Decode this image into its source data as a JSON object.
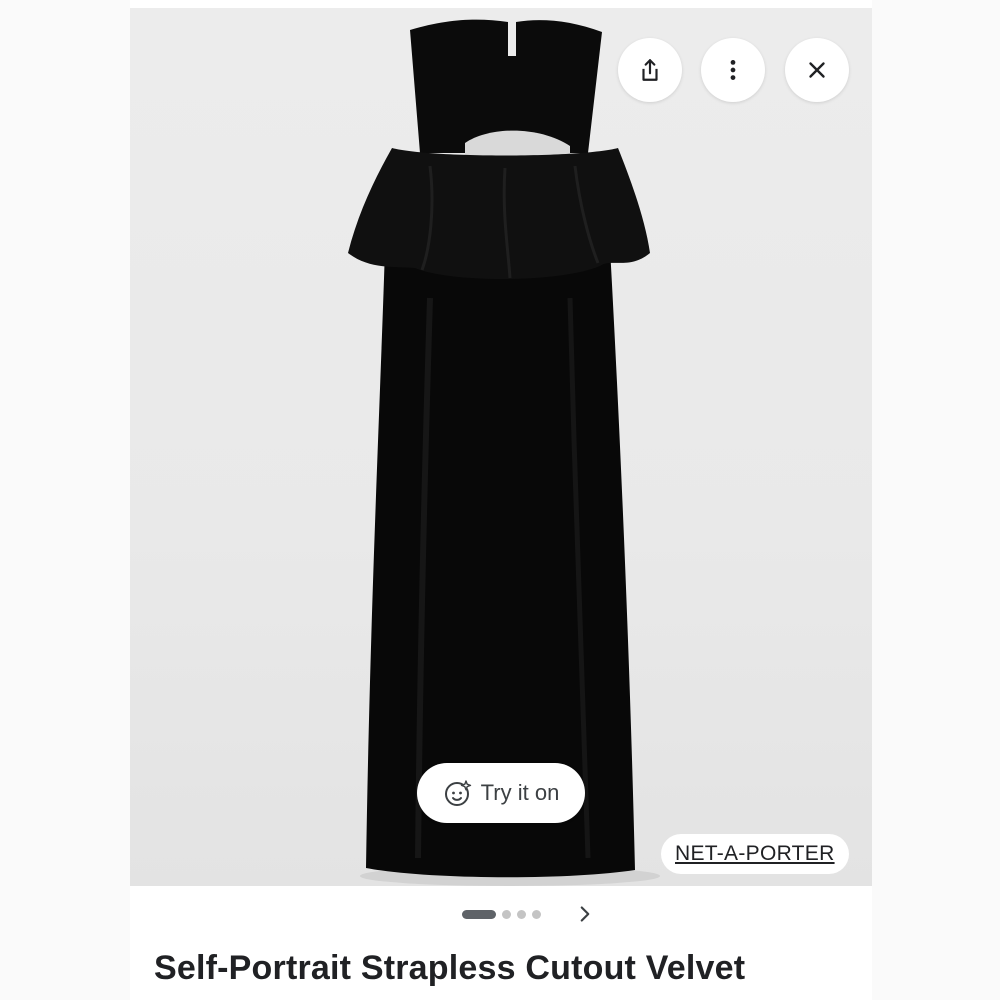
{
  "product": {
    "title": "Self-Portrait Strapless Cutout Velvet",
    "image_alt": "Black strapless velvet maxi dress with peplum"
  },
  "actions": {
    "share_icon": "share-icon",
    "more_icon": "more-vertical-icon",
    "close_icon": "close-icon"
  },
  "try_on": {
    "label": "Try it on",
    "icon": "face-sparkle-icon"
  },
  "source": {
    "label": "NET-A-PORTER"
  },
  "pager": {
    "total": 4,
    "active_index": 0,
    "next_icon": "chevron-right-icon"
  },
  "colors": {
    "background": "#fafafa",
    "hero": "#ebebeb",
    "dress": "#0a0a0a",
    "text": "#202124"
  }
}
